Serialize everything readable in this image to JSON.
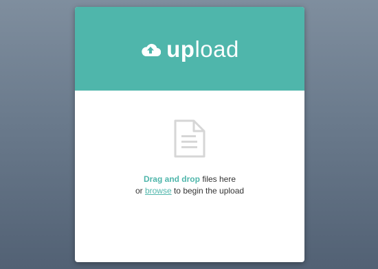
{
  "header": {
    "title_bold": "up",
    "title_light": "load",
    "icon": "cloud-upload-icon"
  },
  "dropzone": {
    "icon": "document-icon",
    "drag_label": "Drag and drop",
    "line1_suffix": " files here",
    "line2_prefix": "or ",
    "browse_label": "browse",
    "line2_suffix": " to begin the upload"
  },
  "colors": {
    "accent": "#4fb6ab",
    "icon_gray": "#d6d6d6"
  }
}
